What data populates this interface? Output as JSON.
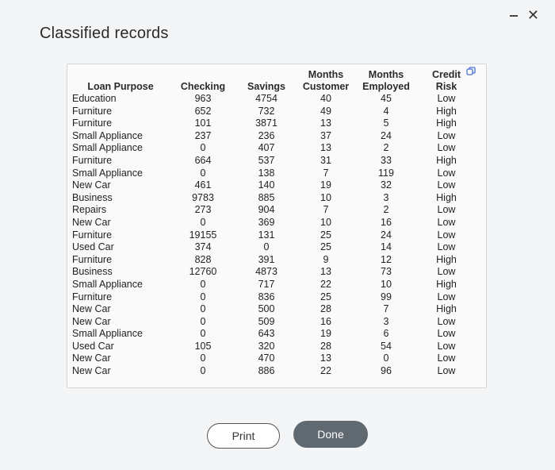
{
  "window": {
    "title": "Classified records",
    "minimize_label": "-",
    "close_label": "✕"
  },
  "table": {
    "headers": [
      [
        "Loan Purpose"
      ],
      [
        "Checking"
      ],
      [
        "Savings"
      ],
      [
        "Months",
        "Customer"
      ],
      [
        "Months",
        "Employed"
      ],
      [
        "Credit",
        "Risk"
      ]
    ],
    "rows": [
      [
        "Education",
        "963",
        "4754",
        "40",
        "45",
        "Low"
      ],
      [
        "Furniture",
        "652",
        "732",
        "49",
        "4",
        "High"
      ],
      [
        "Furniture",
        "101",
        "3871",
        "13",
        "5",
        "High"
      ],
      [
        "Small Appliance",
        "237",
        "236",
        "37",
        "24",
        "Low"
      ],
      [
        "Small Appliance",
        "0",
        "407",
        "13",
        "2",
        "Low"
      ],
      [
        "Furniture",
        "664",
        "537",
        "31",
        "33",
        "High"
      ],
      [
        "Small Appliance",
        "0",
        "138",
        "7",
        "119",
        "Low"
      ],
      [
        "New Car",
        "461",
        "140",
        "19",
        "32",
        "Low"
      ],
      [
        "Business",
        "9783",
        "885",
        "10",
        "3",
        "High"
      ],
      [
        "Repairs",
        "273",
        "904",
        "7",
        "2",
        "Low"
      ],
      [
        "New Car",
        "0",
        "369",
        "10",
        "16",
        "Low"
      ],
      [
        "Furniture",
        "19155",
        "131",
        "25",
        "24",
        "Low"
      ],
      [
        "Used Car",
        "374",
        "0",
        "25",
        "14",
        "Low"
      ],
      [
        "Furniture",
        "828",
        "391",
        "9",
        "12",
        "High"
      ],
      [
        "Business",
        "12760",
        "4873",
        "13",
        "73",
        "Low"
      ],
      [
        "Small Appliance",
        "0",
        "717",
        "22",
        "10",
        "High"
      ],
      [
        "Furniture",
        "0",
        "836",
        "25",
        "99",
        "Low"
      ],
      [
        "New Car",
        "0",
        "500",
        "28",
        "7",
        "High"
      ],
      [
        "New Car",
        "0",
        "509",
        "16",
        "3",
        "Low"
      ],
      [
        "Small Appliance",
        "0",
        "643",
        "19",
        "6",
        "Low"
      ],
      [
        "Used Car",
        "105",
        "320",
        "28",
        "54",
        "Low"
      ],
      [
        "New Car",
        "0",
        "470",
        "13",
        "0",
        "Low"
      ],
      [
        "New Car",
        "0",
        "886",
        "22",
        "96",
        "Low"
      ]
    ]
  },
  "buttons": {
    "print_label": "Print",
    "done_label": "Done"
  },
  "icons": {
    "copy": "copy-icon"
  }
}
